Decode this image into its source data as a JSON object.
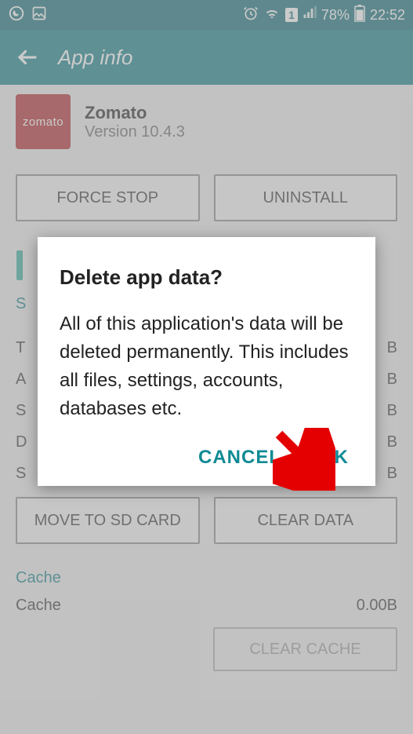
{
  "status": {
    "battery_pct": "78%",
    "time": "22:52",
    "sim_label": "1"
  },
  "header": {
    "title": "App info"
  },
  "app": {
    "icon_text": "zomato",
    "name": "Zomato",
    "version": "Version 10.4.3"
  },
  "buttons": {
    "force_stop": "FORCE STOP",
    "uninstall": "UNINSTALL",
    "move_sd": "MOVE TO SD CARD",
    "clear_data": "CLEAR DATA",
    "clear_cache": "CLEAR CACHE"
  },
  "sections": {
    "storage_hdr_partial": "S",
    "cache_hdr": "Cache"
  },
  "bg_rows": {
    "r1l": "T",
    "r1r": "B",
    "r2l": "A",
    "r2r": "B",
    "r3l": "S",
    "r3r": "B",
    "r4l": "D",
    "r4r": "B",
    "r5l": "S",
    "r5r": "B"
  },
  "cache": {
    "label": "Cache",
    "value": "0.00B"
  },
  "dialog": {
    "title": "Delete app data?",
    "body": "All of this application's data will be deleted permanently. This includes all files, settings, accounts, databases etc.",
    "cancel": "CANCEL",
    "ok": "OK"
  }
}
